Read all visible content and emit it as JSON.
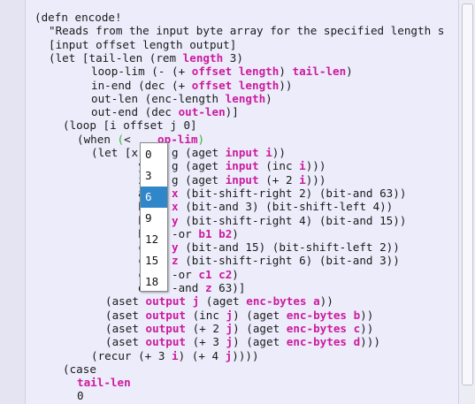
{
  "editor": {
    "lines": [
      {
        "indent": 10,
        "tokens": [
          {
            "t": "(defn encode!",
            "c": "s"
          }
        ]
      },
      {
        "indent": 26,
        "tokens": [
          {
            "t": "\"Reads from the input byte array for the specified length s",
            "c": "s"
          }
        ]
      },
      {
        "indent": 26,
        "tokens": [
          {
            "t": "[input offset length output]",
            "c": "s"
          }
        ]
      },
      {
        "indent": 26,
        "tokens": [
          {
            "t": "(let [tail-len (rem ",
            "c": "s"
          },
          {
            "t": "length",
            "c": "k"
          },
          {
            "t": " 3)",
            "c": "s"
          }
        ]
      },
      {
        "indent": 74,
        "tokens": [
          {
            "t": "loop-lim (- (+ ",
            "c": "s"
          },
          {
            "t": "offset",
            "c": "k"
          },
          {
            "t": " ",
            "c": "s"
          },
          {
            "t": "length",
            "c": "k"
          },
          {
            "t": ") ",
            "c": "s"
          },
          {
            "t": "tail-len",
            "c": "k"
          },
          {
            "t": ")",
            "c": "s"
          }
        ]
      },
      {
        "indent": 74,
        "tokens": [
          {
            "t": "in-end (dec (+ ",
            "c": "s"
          },
          {
            "t": "offset",
            "c": "k"
          },
          {
            "t": " ",
            "c": "s"
          },
          {
            "t": "length",
            "c": "k"
          },
          {
            "t": "))",
            "c": "s"
          }
        ]
      },
      {
        "indent": 74,
        "tokens": [
          {
            "t": "out-len (enc-length ",
            "c": "s"
          },
          {
            "t": "length",
            "c": "k"
          },
          {
            "t": ")",
            "c": "s"
          }
        ]
      },
      {
        "indent": 74,
        "tokens": [
          {
            "t": "out-end (dec ",
            "c": "s"
          },
          {
            "t": "out-len",
            "c": "k"
          },
          {
            "t": ")]",
            "c": "s"
          }
        ]
      },
      {
        "indent": 42,
        "tokens": [
          {
            "t": "(loop [i offset j 0]",
            "c": "s"
          }
        ]
      },
      {
        "indent": 58,
        "tokens": [
          {
            "t": "(when ",
            "c": "s"
          },
          {
            "t": "(",
            "c": "g"
          },
          {
            "t": "<",
            "c": "s"
          },
          {
            "t": "    ",
            "c": "s"
          },
          {
            "t": "op-lim",
            "c": "k"
          },
          {
            "t": ")",
            "c": "g"
          }
        ]
      },
      {
        "indent": 74,
        "tokens": [
          {
            "t": "(let [x",
            "c": "s"
          },
          {
            "t": "     ",
            "c": "s"
          },
          {
            "t": "g (aget ",
            "c": "s"
          },
          {
            "t": "input",
            "c": "k"
          },
          {
            "t": " ",
            "c": "s"
          },
          {
            "t": "i",
            "c": "k"
          },
          {
            "t": "))",
            "c": "s"
          }
        ]
      },
      {
        "indent": 74,
        "tokens": [
          {
            "t": "       y",
            "c": "s"
          },
          {
            "t": "    ",
            "c": "s"
          },
          {
            "t": "g (aget ",
            "c": "s"
          },
          {
            "t": "input",
            "c": "k"
          },
          {
            "t": " (inc ",
            "c": "s"
          },
          {
            "t": "i",
            "c": "k"
          },
          {
            "t": ")))",
            "c": "s"
          }
        ]
      },
      {
        "indent": 74,
        "tokens": [
          {
            "t": "       z",
            "c": "s"
          },
          {
            "t": "    ",
            "c": "s"
          },
          {
            "t": "g (aget ",
            "c": "s"
          },
          {
            "t": "input",
            "c": "k"
          },
          {
            "t": " (+ 2 ",
            "c": "s"
          },
          {
            "t": "i",
            "c": "k"
          },
          {
            "t": ")))",
            "c": "s"
          }
        ]
      },
      {
        "indent": 74,
        "tokens": [
          {
            "t": "       a",
            "c": "s"
          },
          {
            "t": "    ",
            "c": "s"
          },
          {
            "t": "x",
            "c": "k"
          },
          {
            "t": " (bit-shift-right 2) (bit-and 63))",
            "c": "s"
          }
        ]
      },
      {
        "indent": 74,
        "tokens": [
          {
            "t": "       b",
            "c": "s"
          },
          {
            "t": "    ",
            "c": "s"
          },
          {
            "t": "x",
            "c": "k"
          },
          {
            "t": " (bit-and 3) (bit-shift-left 4))",
            "c": "s"
          }
        ]
      },
      {
        "indent": 74,
        "tokens": [
          {
            "t": "       b",
            "c": "s"
          },
          {
            "t": "    ",
            "c": "s"
          },
          {
            "t": "y",
            "c": "k"
          },
          {
            "t": " (bit-shift-right 4) (bit-and 15))",
            "c": "s"
          }
        ]
      },
      {
        "indent": 74,
        "tokens": [
          {
            "t": "       b",
            "c": "s"
          },
          {
            "t": "    ",
            "c": "s"
          },
          {
            "t": "-or ",
            "c": "s"
          },
          {
            "t": "b1 b2",
            "c": "k"
          },
          {
            "t": ")",
            "c": "s"
          }
        ]
      },
      {
        "indent": 74,
        "tokens": [
          {
            "t": "       c",
            "c": "s"
          },
          {
            "t": "    ",
            "c": "s"
          },
          {
            "t": "y",
            "c": "k"
          },
          {
            "t": " (bit-and 15) (bit-shift-left 2))",
            "c": "s"
          }
        ]
      },
      {
        "indent": 74,
        "tokens": [
          {
            "t": "       c",
            "c": "s"
          },
          {
            "t": "    ",
            "c": "s"
          },
          {
            "t": "z",
            "c": "k"
          },
          {
            "t": " (bit-shift-right 6) (bit-and 3))",
            "c": "s"
          }
        ]
      },
      {
        "indent": 74,
        "tokens": [
          {
            "t": "       c",
            "c": "s"
          },
          {
            "t": "    ",
            "c": "s"
          },
          {
            "t": "-or ",
            "c": "s"
          },
          {
            "t": "c1 c2",
            "c": "k"
          },
          {
            "t": ")",
            "c": "s"
          }
        ]
      },
      {
        "indent": 74,
        "tokens": [
          {
            "t": "       d",
            "c": "s"
          },
          {
            "t": "    ",
            "c": "s"
          },
          {
            "t": "-and ",
            "c": "s"
          },
          {
            "t": "z",
            "c": "k"
          },
          {
            "t": " 63)]",
            "c": "s"
          }
        ]
      },
      {
        "indent": 90,
        "tokens": [
          {
            "t": "(aset ",
            "c": "s"
          },
          {
            "t": "output",
            "c": "k"
          },
          {
            "t": " ",
            "c": "s"
          },
          {
            "t": "j",
            "c": "k"
          },
          {
            "t": " (aget ",
            "c": "s"
          },
          {
            "t": "enc-bytes a",
            "c": "k"
          },
          {
            "t": "))",
            "c": "s"
          }
        ]
      },
      {
        "indent": 90,
        "tokens": [
          {
            "t": "(aset ",
            "c": "s"
          },
          {
            "t": "output",
            "c": "k"
          },
          {
            "t": " (inc ",
            "c": "s"
          },
          {
            "t": "j",
            "c": "k"
          },
          {
            "t": ") (aget ",
            "c": "s"
          },
          {
            "t": "enc-bytes b",
            "c": "k"
          },
          {
            "t": "))",
            "c": "s"
          }
        ]
      },
      {
        "indent": 90,
        "tokens": [
          {
            "t": "(aset ",
            "c": "s"
          },
          {
            "t": "output",
            "c": "k"
          },
          {
            "t": " (+ 2 ",
            "c": "s"
          },
          {
            "t": "j",
            "c": "k"
          },
          {
            "t": ") (aget ",
            "c": "s"
          },
          {
            "t": "enc-bytes c",
            "c": "k"
          },
          {
            "t": "))",
            "c": "s"
          }
        ]
      },
      {
        "indent": 90,
        "tokens": [
          {
            "t": "(aset ",
            "c": "s"
          },
          {
            "t": "output",
            "c": "k"
          },
          {
            "t": " (+ 3 ",
            "c": "s"
          },
          {
            "t": "j",
            "c": "k"
          },
          {
            "t": ") (aget ",
            "c": "s"
          },
          {
            "t": "enc-bytes d",
            "c": "k"
          },
          {
            "t": ")))",
            "c": "s"
          }
        ]
      },
      {
        "indent": 74,
        "tokens": [
          {
            "t": "(recur (+ 3 ",
            "c": "s"
          },
          {
            "t": "i",
            "c": "k"
          },
          {
            "t": ") (+ 4 ",
            "c": "s"
          },
          {
            "t": "j",
            "c": "k"
          },
          {
            "t": "))))",
            "c": "s"
          }
        ]
      },
      {
        "indent": 42,
        "tokens": [
          {
            "t": "(case",
            "c": "s"
          }
        ]
      },
      {
        "indent": 58,
        "tokens": [
          {
            "t": "tail-len",
            "c": "k"
          }
        ]
      },
      {
        "indent": 58,
        "tokens": [
          {
            "t": "0",
            "c": "s"
          }
        ]
      }
    ]
  },
  "autocomplete": {
    "selected_index": 2,
    "items": [
      "0",
      "3",
      "6",
      "9",
      "12",
      "15",
      "18"
    ]
  },
  "colors": {
    "background": "#ececfb",
    "keyword": "#cc1b9e",
    "paren_match": "#2db82d",
    "selection": "#2f86c9"
  }
}
